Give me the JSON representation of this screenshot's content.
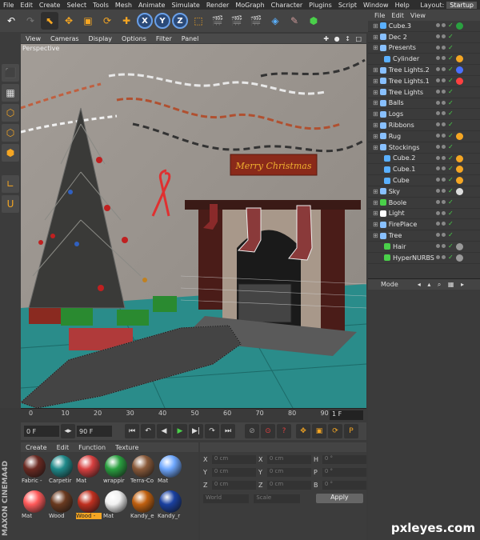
{
  "menu": [
    "File",
    "Edit",
    "Create",
    "Select",
    "Tools",
    "Mesh",
    "Animate",
    "Simulate",
    "Render",
    "MoGraph",
    "Character",
    "Plugins",
    "Script",
    "Window",
    "Help"
  ],
  "layout": {
    "label": "Layout:",
    "value": "Startup"
  },
  "toolbar": {
    "x": "X",
    "y": "Y",
    "z": "Z"
  },
  "viewport_menu": [
    "View",
    "Cameras",
    "Display",
    "Options",
    "Filter",
    "Panel"
  ],
  "viewport_nav": "✚ ● ↕ □",
  "viewport_label": "Perspective",
  "scene": {
    "sign_text": "Merry Christmas"
  },
  "timeline": {
    "ticks": [
      "0",
      "10",
      "20",
      "30",
      "40",
      "50",
      "60",
      "70",
      "80",
      "90"
    ],
    "current_frame": "1 F"
  },
  "playback": {
    "start": "0 F",
    "end": "90 F"
  },
  "materials": {
    "menu": [
      "Create",
      "Edit",
      "Function",
      "Texture"
    ],
    "items": [
      {
        "name": "Fabric - ",
        "color": "#6b2a22"
      },
      {
        "name": "Carpetir",
        "color": "#1f8a8a"
      },
      {
        "name": "Mat",
        "color": "#d84040"
      },
      {
        "name": "wrappir",
        "color": "#2aa040"
      },
      {
        "name": "Terra-Co",
        "color": "#8a5a3a"
      },
      {
        "name": "Mat",
        "color": "#6fa8ff"
      },
      {
        "name": "Mat",
        "color": "#ff5a5a"
      },
      {
        "name": "Wood",
        "color": "#6a3a20"
      },
      {
        "name": "Wood -",
        "color": "#c03020"
      },
      {
        "name": "Mat",
        "color": "#f0f0f0"
      },
      {
        "name": "Kandy_e",
        "color": "#c06010"
      },
      {
        "name": "Kandy_r",
        "color": "#1a40a0"
      }
    ],
    "selected_index": 8
  },
  "brand": "MAXON CINEMA4D",
  "coordinates": {
    "rows": [
      {
        "a": "X",
        "av": "0 cm",
        "b": "X",
        "bv": "0 cm",
        "c": "H",
        "cv": "0 °"
      },
      {
        "a": "Y",
        "av": "0 cm",
        "b": "Y",
        "bv": "0 cm",
        "c": "P",
        "cv": "0 °"
      },
      {
        "a": "Z",
        "av": "0 cm",
        "b": "Z",
        "bv": "0 cm",
        "c": "B",
        "cv": "0 °"
      }
    ],
    "mode": "World",
    "scale": "Scale",
    "apply": "Apply"
  },
  "object_menu": [
    "File",
    "Edit",
    "View"
  ],
  "objects": [
    {
      "name": "Cube.3",
      "indent": 0,
      "icon": "#5ab0ff",
      "tag": "#2aa040"
    },
    {
      "name": "Dec 2",
      "indent": 0,
      "icon": "#88c0ff",
      "tag": ""
    },
    {
      "name": "Presents",
      "indent": 0,
      "icon": "#88c0ff",
      "tag": ""
    },
    {
      "name": "Cylinder",
      "indent": 1,
      "icon": "#5ab0ff",
      "tag": "#f5a623"
    },
    {
      "name": "Tree Lights.2",
      "indent": 0,
      "icon": "#88c0ff",
      "tag": "#4a70ff"
    },
    {
      "name": "Tree Lights.1",
      "indent": 0,
      "icon": "#88c0ff",
      "tag": "#ff4040"
    },
    {
      "name": "Tree Lights",
      "indent": 0,
      "icon": "#88c0ff",
      "tag": ""
    },
    {
      "name": "Balls",
      "indent": 0,
      "icon": "#88c0ff",
      "tag": ""
    },
    {
      "name": "Logs",
      "indent": 0,
      "icon": "#88c0ff",
      "tag": ""
    },
    {
      "name": "Ribbons",
      "indent": 0,
      "icon": "#88c0ff",
      "tag": ""
    },
    {
      "name": "Rug",
      "indent": 0,
      "icon": "#88c0ff",
      "tag": "#f5a623"
    },
    {
      "name": "Stockings",
      "indent": 0,
      "icon": "#88c0ff",
      "tag": ""
    },
    {
      "name": "Cube.2",
      "indent": 1,
      "icon": "#5ab0ff",
      "tag": "#f5a623"
    },
    {
      "name": "Cube.1",
      "indent": 1,
      "icon": "#5ab0ff",
      "tag": "#f5a623"
    },
    {
      "name": "Cube",
      "indent": 1,
      "icon": "#5ab0ff",
      "tag": "#f5a623"
    },
    {
      "name": "Sky",
      "indent": 0,
      "icon": "#88c0ff",
      "tag": "#dddddd"
    },
    {
      "name": "Boole",
      "indent": 0,
      "icon": "#4ad04a",
      "tag": ""
    },
    {
      "name": "Light",
      "indent": 0,
      "icon": "#ffffff",
      "tag": ""
    },
    {
      "name": "FirePlace",
      "indent": 0,
      "icon": "#88c0ff",
      "tag": ""
    },
    {
      "name": "Tree",
      "indent": 0,
      "icon": "#88c0ff",
      "tag": ""
    },
    {
      "name": "Hair",
      "indent": 1,
      "icon": "#4ad04a",
      "tag": "#999999"
    },
    {
      "name": "HyperNURBS",
      "indent": 1,
      "icon": "#4ad04a",
      "tag": "#999999"
    }
  ],
  "attributes": {
    "mode": "Mode"
  },
  "watermark": "pxleyes.com"
}
